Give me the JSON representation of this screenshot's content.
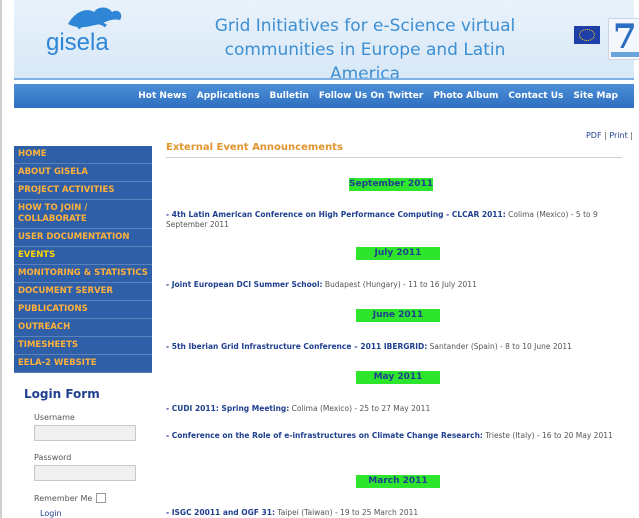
{
  "header": {
    "logo_text": "gisela",
    "title_line1": "Grid Initiatives for e-Science virtual",
    "title_line2": "communities in Europe and Latin America",
    "right_logo_text": "7"
  },
  "nav": {
    "items": [
      "Hot News",
      "Applications",
      "Bulletin",
      "Follow Us On Twitter",
      "Photo Album",
      "Contact Us",
      "Site Map"
    ]
  },
  "toolbar": {
    "pdf_label": "PDF",
    "print_label": "Print"
  },
  "sidebar": {
    "menu": [
      "HOME",
      "ABOUT GISELA",
      "PROJECT ACTIVITIES",
      "HOW TO JOIN / COLLABORATE",
      "USER DOCUMENTATION",
      "EVENTS",
      "MONITORING & STATISTICS",
      "DOCUMENT SERVER",
      "PUBLICATIONS",
      "OUTREACH",
      "TIMESHEETS",
      "EELA-2 WEBSITE"
    ]
  },
  "login": {
    "title": "Login Form",
    "username_label": "Username",
    "password_label": "Password",
    "remember_label": "Remember Me",
    "login_label": "Login"
  },
  "content": {
    "page_title": "External Event Announcements",
    "months": [
      "September 2011",
      "July 2011",
      "June 2011",
      "May 2011",
      "March 2011"
    ],
    "events": [
      {
        "title": "- 4th Latin American Conference on High Performance Computing - CLCAR 2011:",
        "details": " Colima (Mexico) - 5 to 9",
        "details2": "September 2011"
      },
      {
        "title": "- Joint European DCI Summer School:",
        "details": " Budapest (Hungary) - 11 to 16 July 2011"
      },
      {
        "title": "- 5th Iberian Grid Infrastructure Conference – 2011 IBERGRID:",
        "details": " Santander (Spain) - 8 to 10 June 2011"
      },
      {
        "title": "- CUDI 2011: Spring Meeting:",
        "details": " Colima (Mexico) - 25 to 27 May 2011"
      },
      {
        "title": "- Conference on the Role of e-infrastructures on Climate Change Research:",
        "details": " Trieste (Italy) - 16 to 20 May 2011"
      },
      {
        "title": "- ISGC 20011 and OGF 31:",
        "details": " Taipei (Taiwan) - 19 to 25 March 2011"
      }
    ]
  }
}
